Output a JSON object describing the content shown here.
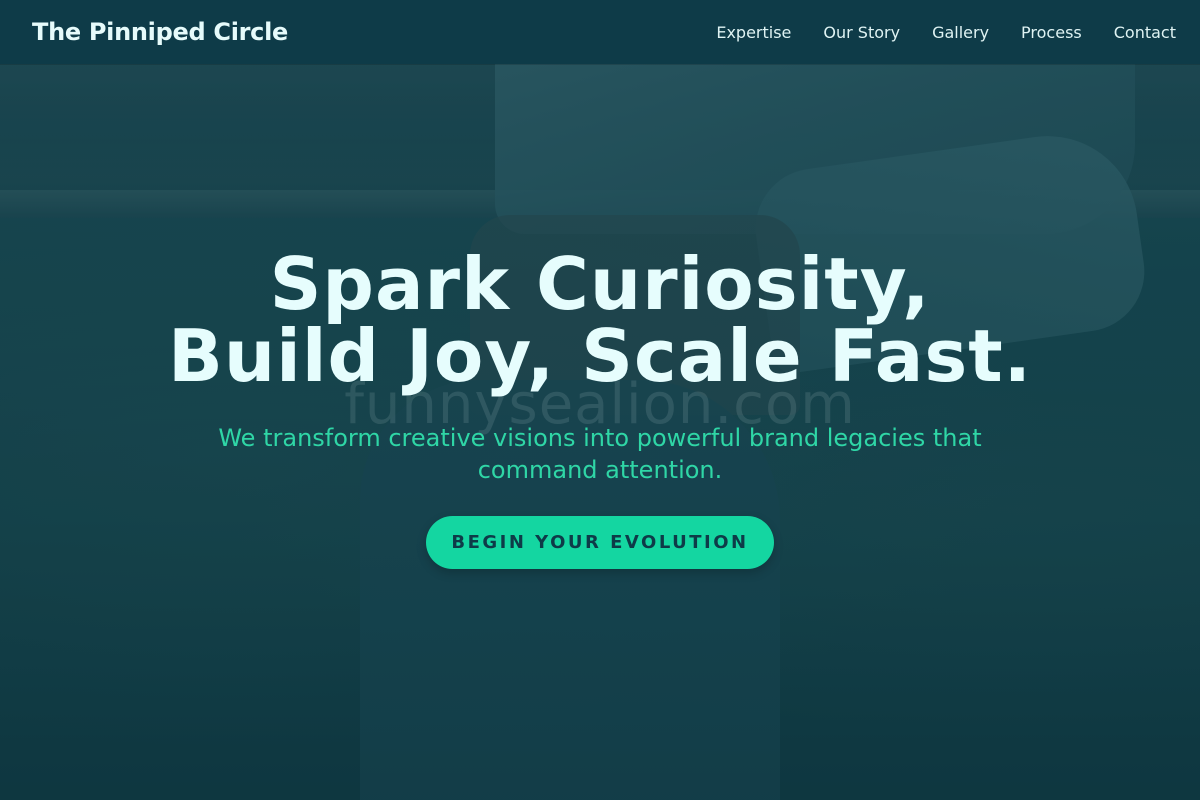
{
  "header": {
    "brand": "The Pinniped Circle",
    "nav": [
      {
        "label": "Expertise"
      },
      {
        "label": "Our Story"
      },
      {
        "label": "Gallery"
      },
      {
        "label": "Process"
      },
      {
        "label": "Contact"
      }
    ]
  },
  "hero": {
    "headline_line1": "Spark Curiosity,",
    "headline_line2": "Build Joy, Scale Fast.",
    "subheadline": "We transform creative visions into powerful brand legacies that command attention.",
    "cta_label": "BEGIN YOUR EVOLUTION",
    "watermark": "funnysealion.com"
  },
  "colors": {
    "header_bg": "#0e3b48",
    "headline": "#e6fdfd",
    "accent": "#14d6a1",
    "subheadline": "#2fd6a6"
  }
}
